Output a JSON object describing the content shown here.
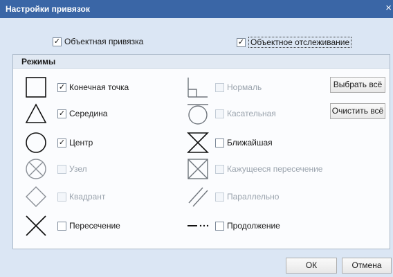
{
  "window": {
    "title": "Настройки привязок",
    "close_glyph": "×"
  },
  "top": {
    "object_snap": {
      "label": "Объектная привязка",
      "checked": true
    },
    "object_tracking": {
      "label": "Объектное отслеживание",
      "checked": true
    }
  },
  "modes": {
    "title": "Режимы",
    "check_glyph": "✓",
    "items": [
      {
        "label": "Конечная точка",
        "checked": true,
        "enabled": true,
        "icon": "square-icon"
      },
      {
        "label": "Середина",
        "checked": true,
        "enabled": true,
        "icon": "triangle-icon"
      },
      {
        "label": "Центр",
        "checked": true,
        "enabled": true,
        "icon": "circle-icon"
      },
      {
        "label": "Узел",
        "checked": false,
        "enabled": false,
        "icon": "node-icon"
      },
      {
        "label": "Квадрант",
        "checked": false,
        "enabled": false,
        "icon": "diamond-icon"
      },
      {
        "label": "Пересечение",
        "checked": false,
        "enabled": true,
        "icon": "cross-icon"
      },
      {
        "label": "Нормаль",
        "checked": false,
        "enabled": false,
        "icon": "perpendicular-icon"
      },
      {
        "label": "Касательная",
        "checked": false,
        "enabled": false,
        "icon": "tangent-icon"
      },
      {
        "label": "Ближайшая",
        "checked": false,
        "enabled": true,
        "icon": "nearest-icon"
      },
      {
        "label": "Кажущееся пересечение",
        "checked": false,
        "enabled": false,
        "icon": "apparent-intersection-icon"
      },
      {
        "label": "Параллельно",
        "checked": false,
        "enabled": false,
        "icon": "parallel-icon"
      },
      {
        "label": "Продолжение",
        "checked": false,
        "enabled": true,
        "icon": "extension-icon"
      }
    ]
  },
  "buttons": {
    "select_all": "Выбрать всё",
    "clear_all": "Очистить всё",
    "ok": "ОК",
    "cancel": "Отмена"
  },
  "colors": {
    "titlebar": "#3a66a6",
    "dialog_bg": "#dbe6f4",
    "disabled_text": "#9aa3ad"
  }
}
